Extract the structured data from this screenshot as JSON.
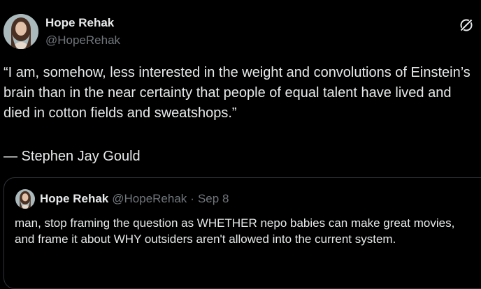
{
  "post": {
    "author": {
      "display_name": "Hope Rehak",
      "handle": "@HopeRehak"
    },
    "icons": {
      "grok": "grok-icon"
    },
    "text": "“I am, somehow, less interested in the weight and convolutions of Einstein’s brain than in the near certainty that people of equal talent have lived and died in cotton fields and sweatshops.”",
    "attribution": "— Stephen Jay Gould"
  },
  "quoted_post": {
    "author": {
      "display_name": "Hope Rehak",
      "handle": "@HopeRehak"
    },
    "separator": "·",
    "date": "Sep 8",
    "text": "man, stop framing the question as WHETHER nepo babies can make great movies, and frame it about WHY outsiders aren't allowed into the current system."
  },
  "colors": {
    "background": "#000000",
    "text_primary": "#e7e9ea",
    "text_secondary": "#71767b",
    "border": "#2f3336"
  }
}
